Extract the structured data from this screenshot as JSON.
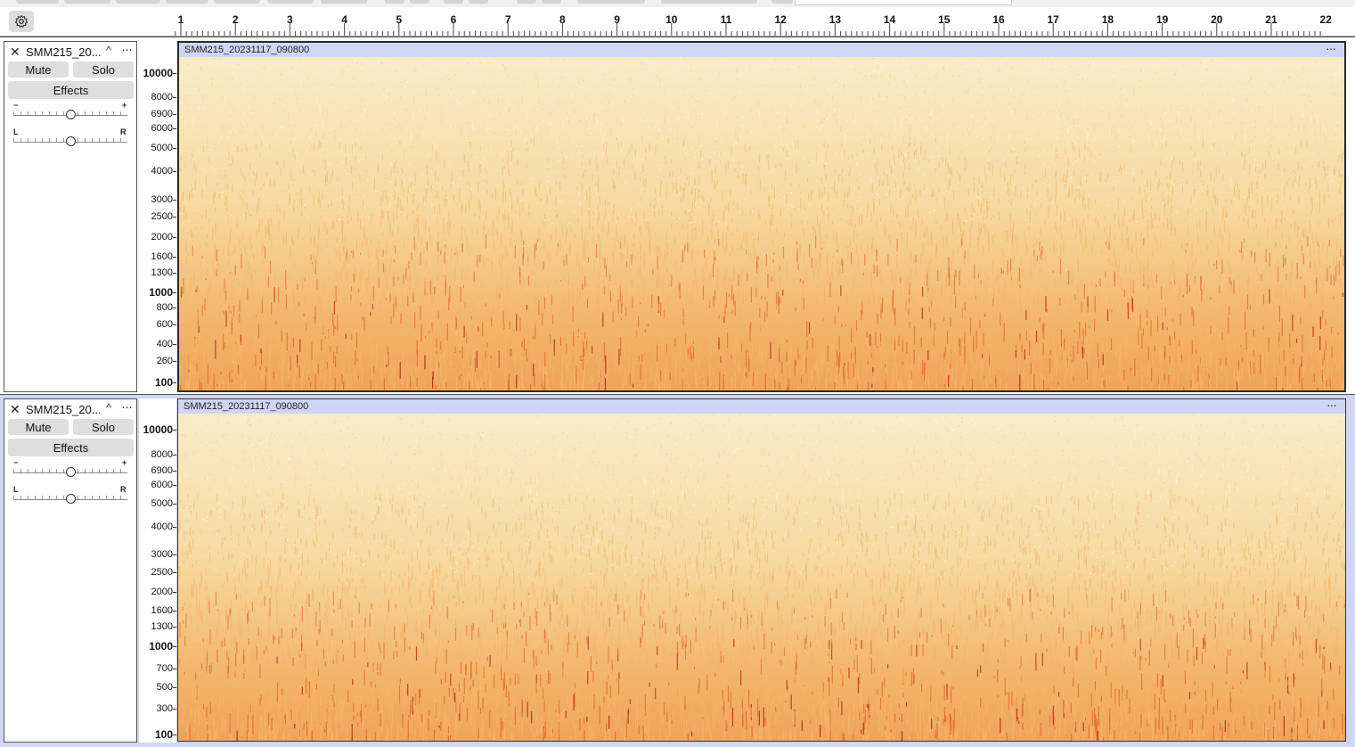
{
  "toolbar": {
    "settings_icon": "gear-icon"
  },
  "ruler": {
    "ticks": [
      "1",
      "2",
      "3",
      "4",
      "5",
      "6",
      "7",
      "8",
      "9",
      "10",
      "11",
      "12",
      "13",
      "14",
      "15",
      "16",
      "17",
      "18",
      "19",
      "20",
      "21",
      "22"
    ]
  },
  "colors": {
    "clip_header": "#cfd6f5",
    "spec_low": "#f8ecc8",
    "spec_mid": "#f3b56a",
    "spec_high": "#e5692e",
    "spec_peak": "#b51d16"
  },
  "tracks": [
    {
      "name": "SMM215_20...",
      "clip_title": "SMM215_20231117_090800",
      "mute_label": "Mute",
      "solo_label": "Solo",
      "effects_label": "Effects",
      "gain_min": "−",
      "gain_max": "+",
      "pan_left": "L",
      "pan_right": "R",
      "gain_level": 0.5,
      "pan_level": 0.5,
      "freq_labels": [
        "10000",
        "8000",
        "6900",
        "6000",
        "5000",
        "4000",
        "3000",
        "2500",
        "2000",
        "1600",
        "1300",
        "1000",
        "800",
        "600",
        "400",
        "260",
        "100"
      ]
    },
    {
      "name": "SMM215_20...",
      "clip_title": "SMM215_20231117_090800",
      "mute_label": "Mute",
      "solo_label": "Solo",
      "effects_label": "Effects",
      "gain_min": "−",
      "gain_max": "+",
      "pan_left": "L",
      "pan_right": "R",
      "gain_level": 0.5,
      "pan_level": 0.5,
      "freq_labels": [
        "10000",
        "8000",
        "6900",
        "6000",
        "5000",
        "4000",
        "3000",
        "2500",
        "2000",
        "1600",
        "1300",
        "1000",
        "700",
        "500",
        "300",
        "100"
      ]
    }
  ]
}
